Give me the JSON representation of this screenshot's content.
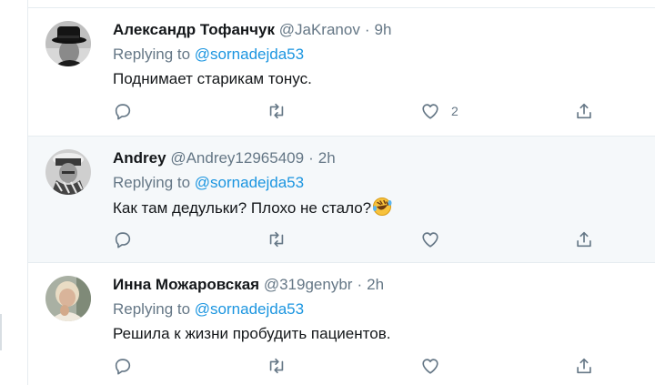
{
  "tweets": [
    {
      "name": "Александр Тофанчук",
      "handle": "@JaKranov",
      "time": "9h",
      "reply_prefix": "Replying to",
      "reply_to": "@sornadejda53",
      "text": "Поднимает старикам тонус.",
      "like_count": "2",
      "avatar_icon": "avatar-man-black-hat"
    },
    {
      "name": "Andrey",
      "handle": "@Andrey12965409",
      "time": "2h",
      "reply_prefix": "Replying to",
      "reply_to": "@sornadejda53",
      "text": "Как там дедульки? Плохо не стало?",
      "emoji": "rolling-on-floor-laughing-emoji",
      "like_count": "",
      "avatar_icon": "avatar-man-hat-scarf"
    },
    {
      "name": "Инна Можаровская",
      "handle": "@319genybr",
      "time": "2h",
      "reply_prefix": "Replying to",
      "reply_to": "@sornadejda53",
      "text": "Решила к жизни пробудить пациентов.",
      "like_count": "",
      "avatar_icon": "avatar-woman-blonde"
    }
  ],
  "colors": {
    "name": "#14171a",
    "secondary": "#657786",
    "link": "#1b95e0",
    "highlight_bg": "#f5f8fa",
    "border": "#e6ecf0"
  },
  "icons": [
    "reply-icon",
    "retweet-icon",
    "like-icon",
    "share-icon"
  ]
}
